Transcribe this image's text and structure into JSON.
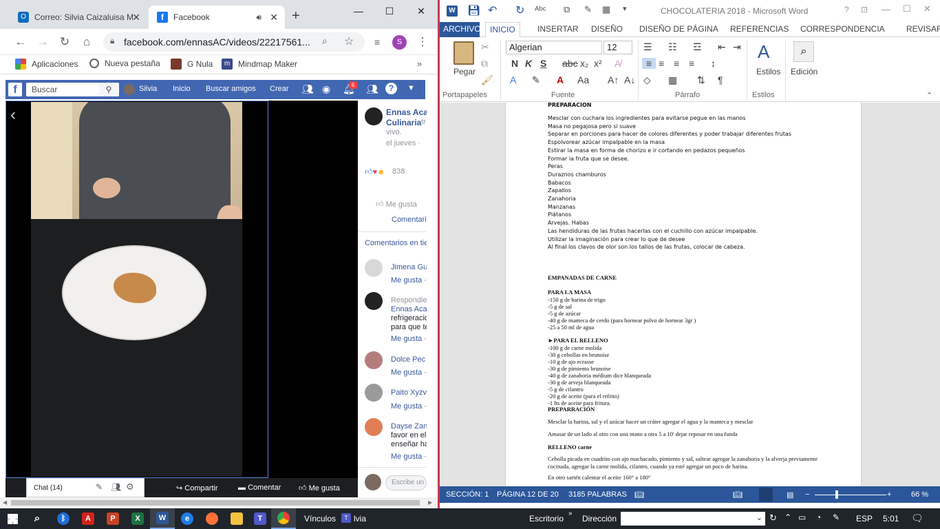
{
  "chrome": {
    "tabs": [
      {
        "title": "Correo: Silvia Caizaluisa M"
      },
      {
        "title": "Facebook"
      }
    ],
    "new_tab": "+",
    "url": "facebook.com/ennasAC/videos/22217561...",
    "profile_initial": "S",
    "bookmarks": [
      "Aplicaciones",
      "Nueva pestaña",
      "G Nula",
      "Mindmap Maker"
    ]
  },
  "facebook": {
    "search_placeholder": "Buscar",
    "user": "Silvia",
    "nav": [
      "Inicio",
      "Buscar amigos",
      "Crear"
    ],
    "notif_count": "6",
    "page_name_line1": "Ennas Aca",
    "page_name_line2": "Culinaria",
    "page_name_suffix": "tr",
    "status": "vivo.",
    "date": "el jueves ·",
    "reactions_count": "838",
    "like_label": "Me gusta",
    "comment_label": "Comentari",
    "comments_header": "Comentarios en tie",
    "comments": [
      {
        "name": "Jimena Gu",
        "lines": [],
        "action": "Me gusta ·"
      },
      {
        "name": "Respondie",
        "lines": [
          "Ennas Aca",
          "refrigeracio",
          "para que te"
        ],
        "action": "Me gusta ·"
      },
      {
        "name": "Dolce Pec",
        "lines": [],
        "action": "Me gusta ·"
      },
      {
        "name": "Paito Xyzv",
        "lines": [],
        "action": "Me gusta ·"
      },
      {
        "name": "Dayse Zan",
        "lines": [
          "favor en el",
          "enseñar ha"
        ],
        "action": "Me gusta ·"
      }
    ],
    "write_placeholder": "Escribe un",
    "chat_label": "Chat (14)",
    "share_label": "Compartir",
    "comment_bar_label": "Comentar",
    "like_bar_label": "Me gusta"
  },
  "word": {
    "title": "CHOCOLATERIA 2018 - Microsoft Word",
    "tabs": [
      "ARCHIVO",
      "INICIO",
      "INSERTAR",
      "DISEÑO",
      "DISEÑO DE PÁGINA",
      "REFERENCIAS",
      "CORRESPONDENCIA",
      "REVISAR"
    ],
    "font_name": "Algerian",
    "font_size": "12",
    "groups": [
      "Portapapeles",
      "Fuente",
      "Párrafo",
      "Estilos"
    ],
    "paste_label": "Pegar",
    "styles_label": "Estilos",
    "edit_label": "Edición",
    "doc_lines_sans": [
      "PREPARACIÓN",
      "Mesclar con cuchara los ingredientes para evitarse pegue en las manos",
      "Masa no pegajosa pero si suave",
      "Separar en porciones para hacer de colores diferentes y poder trabajar diferentes frutas",
      "Espolvorear azúcar impalpable en la masa",
      "Estirar la masa en forma de chorizo e ir cortando en pedazos pequeños",
      "Formar la fruta que se desee.",
      "Peras",
      "Duraznos chamburos",
      "Babacos",
      "Zapallos",
      "Zanahoria",
      "Manzanas",
      "Plátanos",
      "Arvejas. Habas",
      "Las hendiduras de las frutas hacerlas con el cuchillo con azúcar impalpable.",
      "Utilizar la imaginación para crear lo que de desee",
      "Al final los clavos de olor son los tallos de las frutas, colocar de cabeza."
    ],
    "empanadas_title": "EMPANADAS DE CARNE",
    "masa_title": "PARA LA MASA",
    "masa_lines": [
      "-150 g de harina de trigo",
      "-5 g de sal",
      "-5 g de azúcar",
      "-40 g de manteca de cerdo   (para hornear polvo de hornear 3gr )",
      "-25 a 50 ml de agua"
    ],
    "relleno_title": "►PARA EL RELLENO",
    "relleno_lines": [
      "-100 g de carne molida",
      "-30 g cebollas en brunoise",
      "-10 g de ajo ecrasse",
      "-30 g de pimiento brunoise",
      "-40 g de zanahoria médium dice blanqueada",
      "-30 g de arveja blanqueada",
      "-5 g de cilantro",
      "-20 g de aceite (para el refrito)",
      "-1 lts de aceite para fritura."
    ],
    "prep_title": "PREPARRACIÓN",
    "prep_lines": [
      "Mesclar la harina, sal y el azúcar  hacer un cráter agregar el agua y la manteca y mesclar",
      "Amasar de un lado al otro con una mano a otra  5 a 10' dejar reposar en una funda"
    ],
    "relleno2_title": "RELLENO carne",
    "relleno2_lines": [
      "Cebolla picada en cuadrito con ajo machacado, pimiento y sal,  saltear agregar la zanahoria y la alverja previamente",
      "cocinada, agregar la carne molida, cilantro, cuando ya esté agregar un poco de harina.",
      "En otro sartén calentar el aceite 160° a 180°"
    ],
    "status": {
      "section": "SECCIÓN: 1",
      "page": "PÁGINA 12 DE 20",
      "words": "3185 PALABRAS",
      "zoom": "66 %"
    }
  },
  "taskbar": {
    "vinculos": "Vínculos",
    "teams_label": "lvia",
    "escritorio": "Escritorio",
    "direccion": "Dirección",
    "lang": "ESP",
    "time": "5:01"
  },
  "colors": {
    "facebook_blue": "#4267b2",
    "word_blue": "#2b579a",
    "taskbar": "#20242b"
  }
}
